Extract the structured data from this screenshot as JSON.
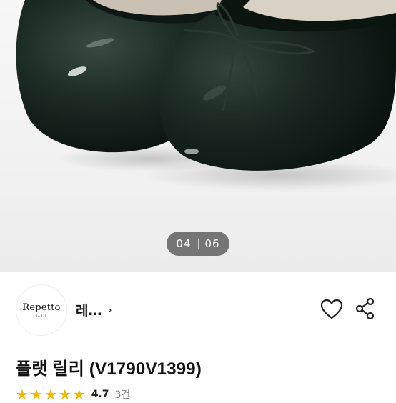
{
  "gallery": {
    "current": "04",
    "total": "06"
  },
  "brand": {
    "logo_text": "Repetto",
    "logo_sub": "PARIS",
    "name": "레…",
    "chevron": "›"
  },
  "actions": {
    "like_icon": "heart-icon",
    "share_icon": "share-icon"
  },
  "product": {
    "title": "플랫 릴리 (V1790V1399)",
    "rating_stars": 5,
    "rating": "4.7",
    "review_count": "3건"
  },
  "colors": {
    "star": "#f5b800",
    "shoe": "#1d2b25"
  }
}
